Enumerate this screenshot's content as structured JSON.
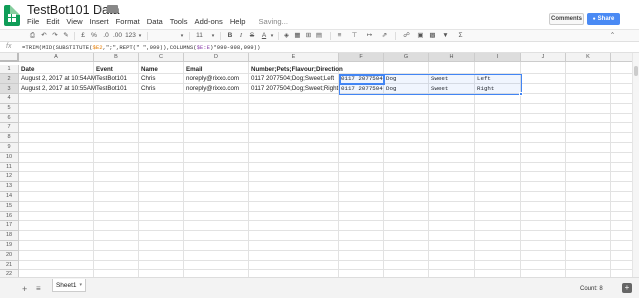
{
  "app": {
    "title": "TestBot101 Data",
    "saving_status": "Saving..."
  },
  "menu": [
    "File",
    "Edit",
    "View",
    "Insert",
    "Format",
    "Data",
    "Tools",
    "Add-ons",
    "Help"
  ],
  "header_buttons": {
    "comments": "Comments",
    "share": "Share"
  },
  "toolbar": {
    "currency": "£",
    "percent": "%",
    "dec_less": ".0",
    "dec_more": ".00",
    "format_more": "123",
    "font_size": "11"
  },
  "formula_bar": {
    "label": "fx",
    "pre": "=TRIM(MID(SUBSTITUTE(",
    "ref1": "$E2",
    "mid": ",\";\",REPT(\" \",999)),COLUMNS(",
    "ref2": "$E:E",
    "post": ")*999-998,999))"
  },
  "columns": [
    "A",
    "B",
    "C",
    "D",
    "E",
    "F",
    "G",
    "H",
    "I",
    "J",
    "K"
  ],
  "rows": [
    "1",
    "2",
    "3",
    "4",
    "5",
    "6",
    "7",
    "8",
    "9",
    "10",
    "11",
    "12",
    "13",
    "14",
    "15",
    "16",
    "17",
    "18",
    "19",
    "20",
    "21",
    "22"
  ],
  "cells": {
    "r1": [
      "Date",
      "Event",
      "Name",
      "Email",
      "Number;Pets;Flavour;Direction"
    ],
    "r2": [
      "August 2, 2017 at 10:54AM",
      "TestBot101",
      "Chris",
      "noreply@rixxo.com",
      "0117 2077504;Dog;Sweet;Left",
      "0117 2077504",
      "Dog",
      "Sweet",
      "Left"
    ],
    "r3": [
      "August 2, 2017 at 10:55AM",
      "TestBot101",
      "Chris",
      "noreply@rixxo.com",
      "0117 2077504;Dog;Sweet;Right",
      "0117 2077504",
      "Dog",
      "Sweet",
      "Right"
    ]
  },
  "sheet_tab": "Sheet1",
  "status": {
    "count": "Count: 8"
  },
  "colors": {
    "brand_green": "#0f9d58",
    "share_blue": "#4a8af4",
    "selection_blue": "#4285f4"
  }
}
